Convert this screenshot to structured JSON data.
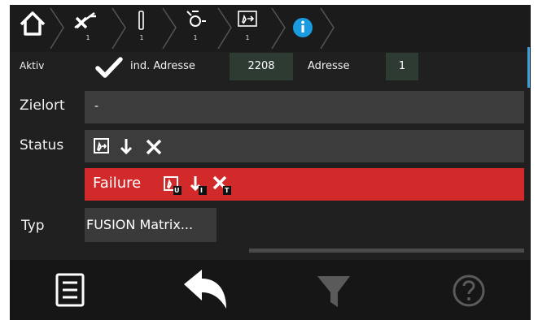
{
  "breadcrumb": {
    "items": [
      {
        "icon": "home-icon"
      },
      {
        "icon": "cross-slash-icon",
        "count": "1"
      },
      {
        "icon": "exclamation-icon",
        "count": "1"
      },
      {
        "icon": "lamp-icon",
        "count": "1"
      },
      {
        "icon": "exit-sign-icon",
        "count": "1"
      },
      {
        "icon": "info-icon"
      }
    ],
    "info_color": "#1a9be0"
  },
  "row1": {
    "aktiv_label": "Aktiv",
    "ind_adresse_label": "ind. Adresse",
    "ind_adresse_value": "2208",
    "adresse_label": "Adresse",
    "adresse_value": "1"
  },
  "zielort": {
    "label": "Zielort",
    "value": "-"
  },
  "status": {
    "label": "Status",
    "icons": [
      "exit-sign-icon",
      "arrow-down-icon",
      "close-icon"
    ]
  },
  "failure": {
    "text": "Failure",
    "color": "#d22a2a",
    "badges": [
      "U",
      "I",
      "T"
    ]
  },
  "typ": {
    "label": "Typ",
    "value": "FUSION Matrix..."
  },
  "toolbar": {
    "buttons": [
      "menu-icon",
      "back-arrow-icon",
      "filter-icon",
      "help-icon"
    ]
  }
}
